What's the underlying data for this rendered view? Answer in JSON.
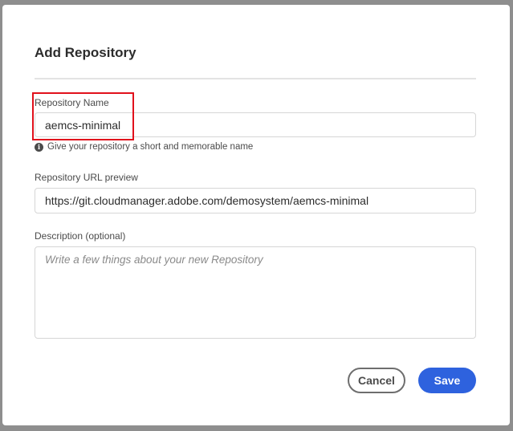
{
  "dialog": {
    "title": "Add Repository",
    "repo_name": {
      "label": "Repository Name",
      "value": "aemcs-minimal",
      "help": "Give your repository a short and memorable name"
    },
    "repo_url": {
      "label": "Repository URL preview",
      "value": "https://git.cloudmanager.adobe.com/demosystem/aemcs-minimal"
    },
    "description": {
      "label": "Description (optional)",
      "placeholder": "Write a few things about your new Repository"
    },
    "buttons": {
      "cancel": "Cancel",
      "save": "Save"
    }
  },
  "colors": {
    "primary": "#2e62de",
    "highlight": "#e1111c"
  },
  "icons": {
    "info": "info-icon"
  }
}
